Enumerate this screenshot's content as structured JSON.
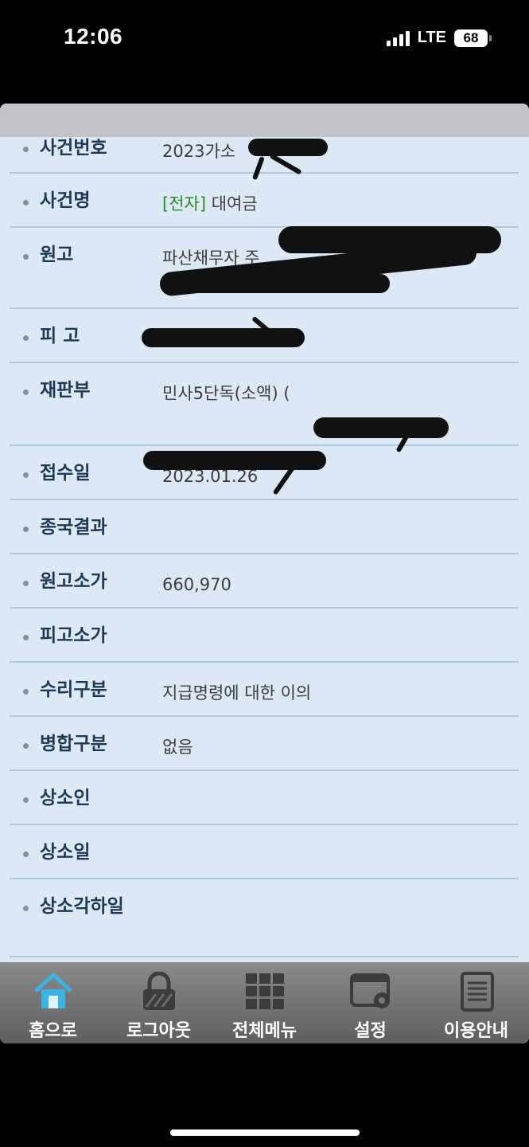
{
  "status": {
    "time": "12:06",
    "network": "LTE",
    "battery": "68"
  },
  "rows": [
    {
      "label": "사건번호",
      "value": "2023가소"
    },
    {
      "label": "사건명",
      "tag": "[전자]",
      "value": "대여금"
    },
    {
      "label": "원고",
      "value": "파산채무자 주"
    },
    {
      "label": "피 고",
      "value": ""
    },
    {
      "label": "재판부",
      "value": "민사5단독(소액) ("
    },
    {
      "label": "접수일",
      "value": "2023.01.26"
    },
    {
      "label": "종국결과",
      "value": ""
    },
    {
      "label": "원고소가",
      "value": "660,970"
    },
    {
      "label": "피고소가",
      "value": ""
    },
    {
      "label": "수리구분",
      "value": "지급명령에 대한 이의"
    },
    {
      "label": "병합구분",
      "value": "없음"
    },
    {
      "label": "상소인",
      "value": ""
    },
    {
      "label": "상소일",
      "value": ""
    },
    {
      "label": "상소각하일",
      "value": ""
    }
  ],
  "tabs": [
    {
      "label": "홈으로",
      "icon": "home-icon"
    },
    {
      "label": "로그아웃",
      "icon": "lock-icon"
    },
    {
      "label": "전체메뉴",
      "icon": "grid-menu-icon"
    },
    {
      "label": "설정",
      "icon": "settings-gear-icon"
    },
    {
      "label": "이용안내",
      "icon": "document-icon"
    }
  ],
  "colors": {
    "card_bg": "#dce9f5",
    "label": "#1f3853",
    "tag_green": "#2c8a2c",
    "home_accent": "#3bb3e6"
  }
}
